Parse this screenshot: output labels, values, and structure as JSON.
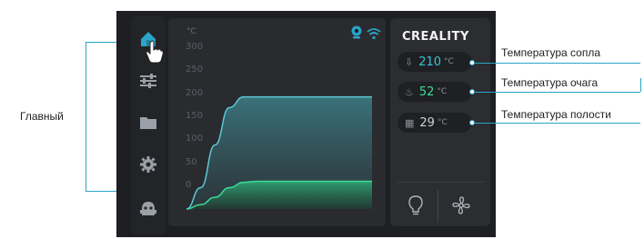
{
  "annotations": {
    "main_label": "Главный",
    "nozzle_label": "Температура сопла",
    "bed_label": "Температура очага",
    "chamber_label": "Температура полости"
  },
  "sidebar": {
    "items": [
      {
        "icon": "home-icon",
        "active": true
      },
      {
        "icon": "sliders-icon"
      },
      {
        "icon": "folder-icon"
      },
      {
        "icon": "gear-icon"
      },
      {
        "icon": "robot-icon"
      }
    ]
  },
  "chart": {
    "unit": "°C",
    "y_ticks": [
      "300",
      "250",
      "200",
      "150",
      "100",
      "50",
      "0"
    ]
  },
  "chart_data": {
    "type": "area",
    "xlabel": "",
    "ylabel": "°C",
    "ylim": [
      0,
      300
    ],
    "yticks": [
      300,
      250,
      200,
      150,
      100,
      50,
      0
    ],
    "series": [
      {
        "x": [
          0,
          1,
          2,
          3,
          4,
          5,
          6,
          7,
          8,
          9,
          10,
          11,
          12,
          13
        ],
        "values": [
          0,
          40,
          120,
          190,
          210,
          210,
          210,
          210,
          210,
          210,
          210,
          210,
          210,
          210
        ]
      },
      {
        "x": [
          0,
          1,
          2,
          3,
          4,
          5,
          6,
          7,
          8,
          9,
          10,
          11,
          12,
          13
        ],
        "values": [
          0,
          8,
          22,
          40,
          50,
          52,
          52,
          52,
          52,
          52,
          52,
          52,
          52,
          52
        ]
      }
    ],
    "colors": [
      "#5bc8d6",
      "#3ddc97"
    ]
  },
  "status_icons": {
    "camera": "camera-icon",
    "wifi": "wifi-icon"
  },
  "brand": {
    "logo": "CREALITY"
  },
  "temps": {
    "nozzle": {
      "value": "210",
      "unit": "°C",
      "color": "#36c5d9",
      "icon": "nozzle-icon"
    },
    "bed": {
      "value": "52",
      "unit": "°C",
      "color": "#3ddc97",
      "icon": "bed-icon"
    },
    "chamber": {
      "value": "29",
      "unit": "°C",
      "color": "#d0d0d0",
      "icon": "chamber-icon"
    }
  },
  "buttons": {
    "light": "lightbulb-icon",
    "fan": "fan-icon"
  },
  "colors": {
    "accent": "#2aa4c8",
    "background": "#1e1f22"
  }
}
